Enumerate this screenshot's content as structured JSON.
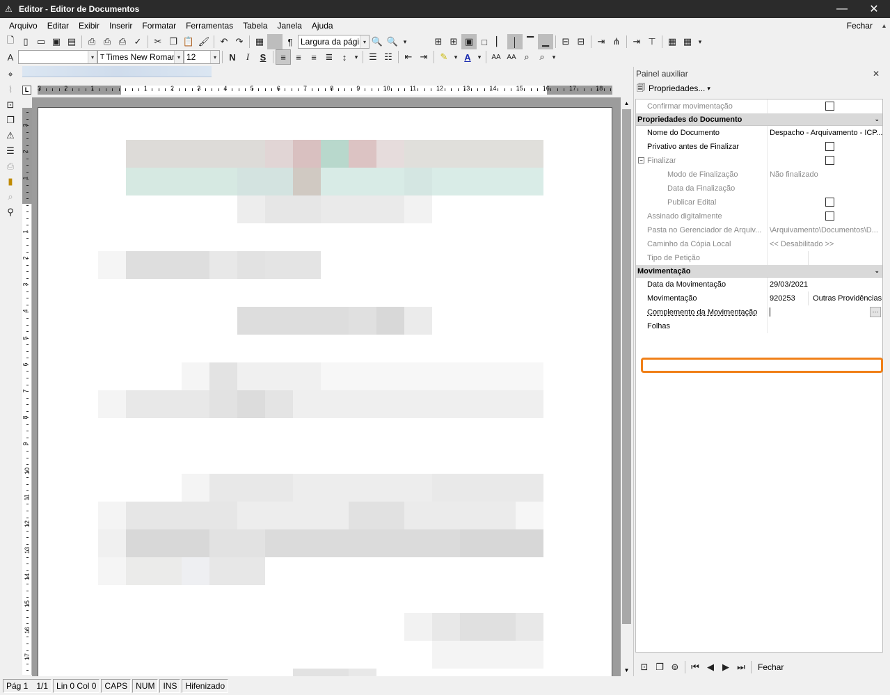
{
  "window": {
    "title": "Editor - Editor de Documentos",
    "minimize": "—",
    "close": "✕"
  },
  "menu": {
    "items": [
      "Arquivo",
      "Editar",
      "Exibir",
      "Inserir",
      "Formatar",
      "Ferramentas",
      "Tabela",
      "Janela",
      "Ajuda"
    ],
    "close_label": "Fechar"
  },
  "toolbar2": {
    "zoom_value": "Largura da págin",
    "font_name": "Times New Roman",
    "font_size": "12",
    "bold": "N",
    "italic": "I",
    "underline": "S"
  },
  "ruler": {
    "horizontal_numbers": [
      "3",
      "2",
      "1",
      "1",
      "2",
      "3",
      "4",
      "5",
      "6",
      "7",
      "8",
      "9",
      "10",
      "11",
      "12",
      "13",
      "14",
      "15",
      "16",
      "17",
      "18"
    ],
    "vertical_numbers": [
      "3",
      "2",
      "1",
      "1",
      "2",
      "3",
      "4",
      "5",
      "6",
      "7",
      "8",
      "9",
      "10",
      "11",
      "12",
      "13",
      "14",
      "15",
      "16",
      "17"
    ],
    "corner": "L"
  },
  "panel": {
    "title": "Painel auxiliar",
    "close": "✕",
    "properties_label": "Propriedades...",
    "rows_top": [
      {
        "label": "Confirmar movimentação",
        "value": "",
        "checkbox": true,
        "disabled": true
      }
    ],
    "section_doc": "Propriedades do Documento",
    "doc_rows": [
      {
        "label": "Nome do Documento",
        "value": "Despacho - Arquivamento - ICP..."
      },
      {
        "label": "Privativo antes de Finalizar",
        "checkbox": true
      },
      {
        "label": "Finalizar",
        "checkbox": true,
        "disabled": true,
        "expander": "⊟"
      },
      {
        "label": "Modo de Finalização",
        "value": "Não finalizado",
        "disabled": true,
        "indent": true
      },
      {
        "label": "Data da Finalização",
        "value": "",
        "disabled": true,
        "indent": true
      },
      {
        "label": "Publicar Edital",
        "checkbox": true,
        "disabled": true,
        "indent": true
      },
      {
        "label": "Assinado digitalmente",
        "checkbox": true,
        "disabled": true
      },
      {
        "label": "Pasta no Gerenciador de Arquiv...",
        "value": "\\Arquivamento\\Documentos\\D...",
        "disabled": true
      },
      {
        "label": "Caminho da Cópia Local",
        "value": "<< Desabilitado >>",
        "disabled": true
      },
      {
        "label": "Tipo de Petição",
        "value": "",
        "disabled": true
      }
    ],
    "section_mov": "Movimentação",
    "mov_rows": {
      "data_label": "Data da Movimentação",
      "data_value": "29/03/2021",
      "mov_label": "Movimentação",
      "mov_code": "920253",
      "mov_desc": "Outras Providências",
      "comp_label": "Complemento da Movimentação",
      "folhas_label": "Folhas"
    },
    "footer_close": "Fechar"
  },
  "status": {
    "page": "Pág 1",
    "pages": "1/1",
    "position": "Lin 0  Col 0",
    "caps": "CAPS",
    "num": "NUM",
    "ins": "INS",
    "hyphen": "Hifenizado"
  }
}
